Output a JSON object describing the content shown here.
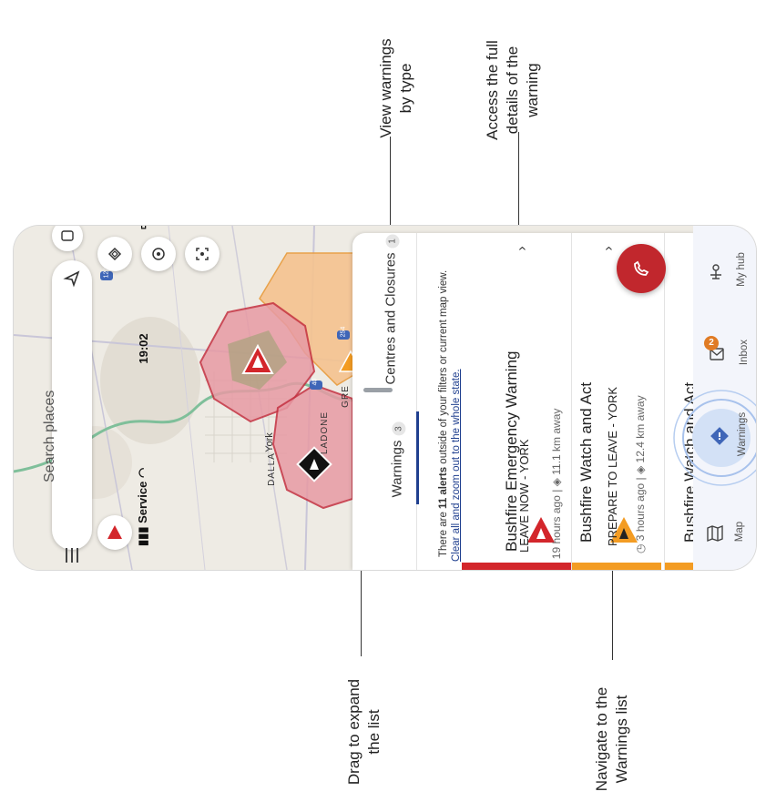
{
  "callouts": {
    "view_by_type": [
      "View warnings",
      "by type"
    ],
    "full_details": [
      "Access the full",
      "details of the",
      "warning"
    ],
    "drag_expand": [
      "Drag to expand",
      "the list"
    ],
    "navigate_warnings": [
      "Navigate to the",
      "Warnings list"
    ]
  },
  "status_bar": {
    "carrier": "Service",
    "time": "19:02"
  },
  "search": {
    "placeholder": "Search places"
  },
  "map": {
    "labels": [
      "York",
      "DALLA",
      "LADONE",
      "GRE"
    ],
    "road_shields": [
      "120",
      "254",
      "40"
    ]
  },
  "sheet": {
    "tabs": [
      {
        "label": "Warnings",
        "count": "3",
        "selected": true
      },
      {
        "label": "Centres and Closures",
        "count": "1",
        "selected": false
      }
    ],
    "notice_prefix": "There are ",
    "notice_bold": "11 alerts",
    "notice_suffix": " outside of your filters or current map view.",
    "notice_link": "Clear all and zoom out to the whole state.",
    "warnings": [
      {
        "title": "Bushfire Emergency Warning",
        "subtitle": "LEAVE NOW - YORK",
        "time": "19 hours ago",
        "distance": "11.1 km away",
        "color": "#d3262b"
      },
      {
        "title": "Bushfire Watch and Act",
        "subtitle": "PREPARE TO LEAVE - YORK",
        "time": "3 hours ago",
        "distance": "12.4 km away",
        "color": "#f39c23"
      },
      {
        "title": "Bushfire Watch and Act",
        "color": "#f39c23"
      }
    ]
  },
  "bottom_nav": {
    "items": [
      {
        "label": "Map",
        "icon": "map-icon"
      },
      {
        "label": "Warnings",
        "icon": "warning-diamond-icon",
        "active": true
      },
      {
        "label": "Inbox",
        "icon": "inbox-icon",
        "badge": "2"
      },
      {
        "label": "My hub",
        "icon": "hub-icon"
      }
    ]
  },
  "colors": {
    "emergency_red": "#d3262b",
    "watch_act_orange": "#f39c23",
    "accent_blue": "#1f3f8f",
    "fab_red": "#c1272d"
  }
}
